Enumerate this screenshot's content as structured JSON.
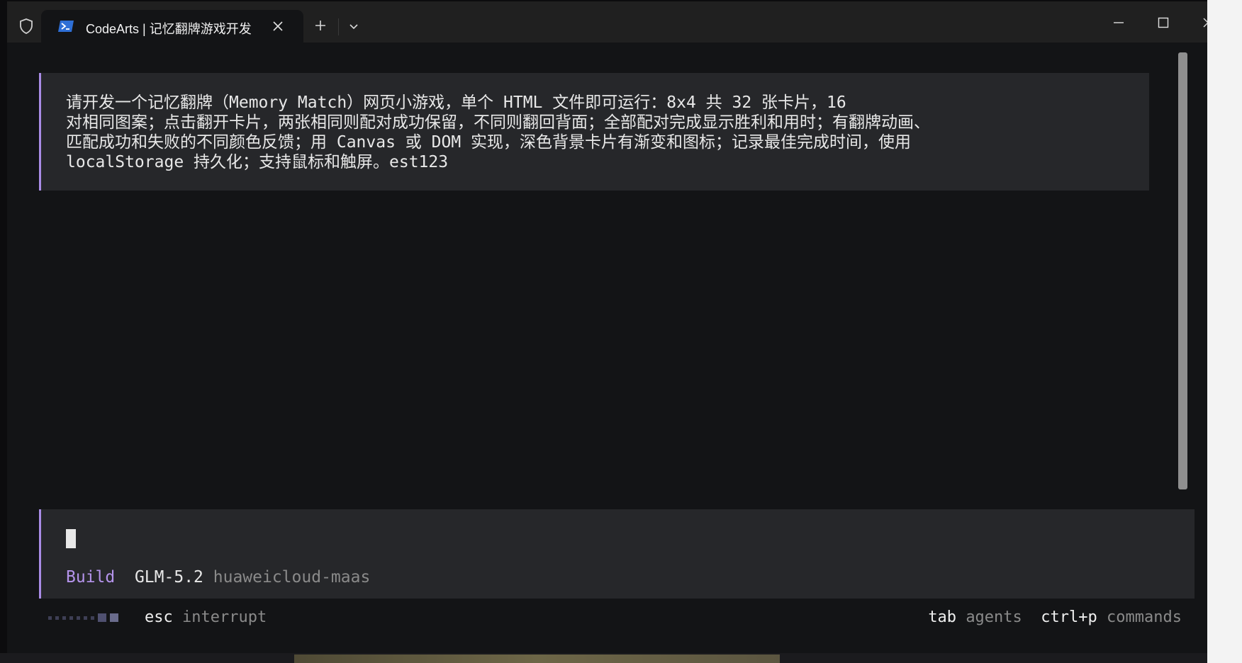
{
  "titlebar": {
    "tab_title": "CodeArts | 记忆翻牌游戏开发",
    "icons": [
      "shield-icon",
      "powershell-icon",
      "close-icon",
      "plus-icon",
      "chevron-down-icon",
      "minimize-icon",
      "maximize-icon",
      "window-close-icon"
    ]
  },
  "prompt": {
    "lines": [
      "请开发一个记忆翻牌（Memory Match）网页小游戏，单个 HTML 文件即可运行：8x4 共 32 张卡片，16",
      "对相同图案；点击翻开卡片，两张相同则配对成功保留，不同则翻回背面；全部配对完成显示胜利和用时；有翻牌动画、",
      "匹配成功和失败的不同颜色反馈；用 Canvas 或 DOM 实现，深色背景卡片有渐变和图标；记录最佳完成时间，使用",
      "localStorage 持久化；支持鼠标和触屏。est123"
    ]
  },
  "input": {
    "mode": "Build",
    "model": "GLM-5.2",
    "provider": "huaweicloud-maas"
  },
  "footer": {
    "left_key": "esc",
    "left_hint": "interrupt",
    "right_key1": "tab",
    "right_hint1": "agents",
    "right_key2": "ctrl+p",
    "right_hint2": "commands"
  },
  "colors": {
    "accent": "#a98ce6",
    "background": "#131416",
    "panel": "#26272a",
    "dim_text": "#8a8a8a"
  }
}
